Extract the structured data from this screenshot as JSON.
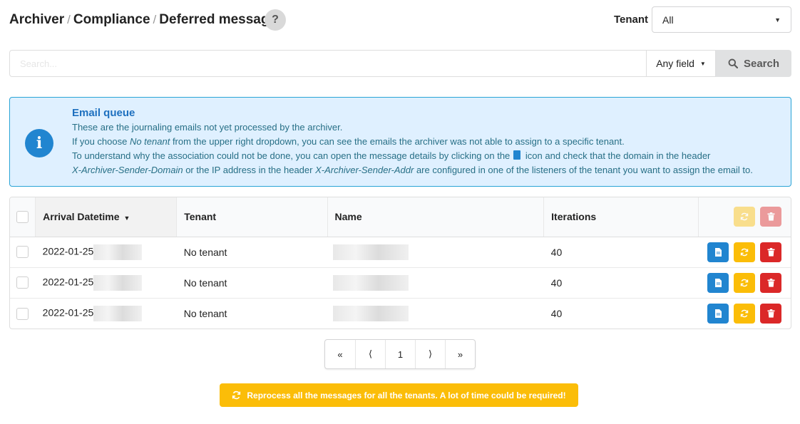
{
  "breadcrumb": {
    "items": [
      "Archiver",
      "Compliance",
      "Deferred messages"
    ],
    "separator": "/"
  },
  "help": {
    "label": "?"
  },
  "tenant": {
    "label": "Tenant",
    "selected": "All"
  },
  "search": {
    "placeholder": "Search...",
    "field_selected": "Any field",
    "button_label": "Search"
  },
  "info": {
    "title": "Email queue",
    "line1": "These are the journaling emails not yet processed by the archiver.",
    "line2_pre": "If you choose ",
    "line2_em": "No tenant",
    "line2_post": " from the upper right dropdown, you can see the emails the archiver was not able to assign to a specific tenant.",
    "line3_pre": "To understand why the association could not be done, you can open the message details by clicking on the",
    "line3_post": "icon and check that the domain in the header",
    "line4_em1": "X-Archiver-Sender-Domain",
    "line4_mid": " or the IP address in the header ",
    "line4_em2": "X-Archiver-Sender-Addr",
    "line4_post": " are configured in one of the listeners of the tenant you want to assign the email to."
  },
  "table": {
    "columns": [
      "Arrival Datetime",
      "Tenant",
      "Name",
      "Iterations"
    ],
    "sorted_column": "Arrival Datetime",
    "rows": [
      {
        "arrival": "2022-01-25",
        "tenant": "No tenant",
        "iterations": "40"
      },
      {
        "arrival": "2022-01-25",
        "tenant": "No tenant",
        "iterations": "40"
      },
      {
        "arrival": "2022-01-25",
        "tenant": "No tenant",
        "iterations": "40"
      }
    ]
  },
  "pagination": {
    "first": "«",
    "prev": "⟨",
    "current": "1",
    "next": "⟩",
    "last": "»"
  },
  "reprocess": {
    "label": "Reprocess all the messages for all the tenants. A lot of time could be required!"
  },
  "colors": {
    "primary": "#2185d0",
    "warning": "#fbbd08",
    "danger": "#db2828",
    "info_bg": "#dff0ff",
    "info_border": "#2aa4d6"
  }
}
